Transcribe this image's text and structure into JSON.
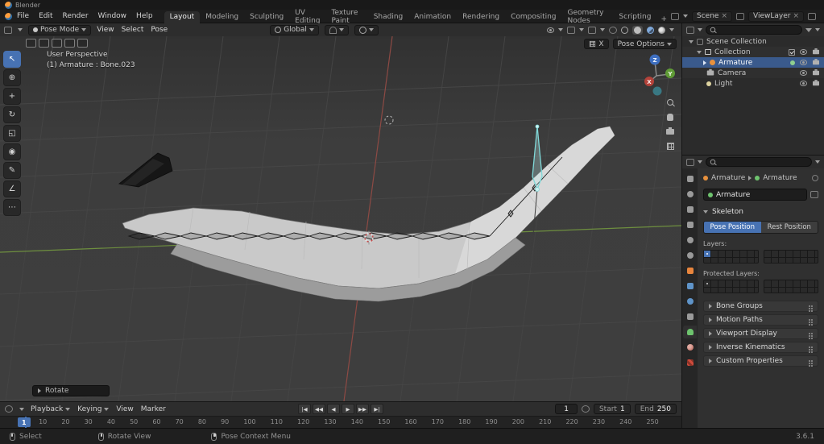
{
  "app": {
    "title": "Blender",
    "version": "3.6.1"
  },
  "menubar": {
    "menus": [
      "File",
      "Edit",
      "Render",
      "Window",
      "Help"
    ]
  },
  "workspaces": {
    "tabs": [
      "Layout",
      "Modeling",
      "Sculpting",
      "UV Editing",
      "Texture Paint",
      "Shading",
      "Animation",
      "Rendering",
      "Compositing",
      "Geometry Nodes",
      "Scripting"
    ],
    "active": "Layout",
    "add": "+"
  },
  "scene_bar": {
    "scene": "Scene",
    "view_layer": "ViewLayer",
    "clear": "×"
  },
  "tools": {
    "items": [
      "↖",
      "⊕",
      "+",
      "↻",
      "◱",
      "◉",
      "✎",
      "∠",
      "⋯"
    ]
  },
  "viewport": {
    "header": {
      "mode": "Pose Mode",
      "menus": [
        "View",
        "Select",
        "Pose"
      ],
      "orientation": "Global"
    },
    "subheader": {
      "mirror": "X",
      "pose_options": "Pose Options"
    },
    "overlay": {
      "line1": "User Perspective",
      "line2": "(1) Armature : Bone.023"
    },
    "operator": "Rotate",
    "gizmo": {
      "x": "X",
      "y": "Y",
      "z": "Z"
    }
  },
  "outliner": {
    "root": "Scene Collection",
    "items": [
      {
        "label": "Collection"
      },
      {
        "label": "Armature"
      },
      {
        "label": "Camera"
      },
      {
        "label": "Light"
      }
    ]
  },
  "properties": {
    "breadcrumb": {
      "object": "Armature",
      "data": "Armature"
    },
    "name": "Armature",
    "skeleton": {
      "title": "Skeleton",
      "pose_position": "Pose Position",
      "rest_position": "Rest Position",
      "layers_label": "Layers:",
      "protected_label": "Protected Layers:"
    },
    "sections": [
      "Bone Groups",
      "Motion Paths",
      "Viewport Display",
      "Inverse Kinematics",
      "Custom Properties"
    ]
  },
  "timeline": {
    "menus": [
      "Playback",
      "Keying",
      "View",
      "Marker"
    ],
    "transport": [
      "|◀",
      "◀◀",
      "◀",
      "▶",
      "▶▶",
      "▶|"
    ],
    "current_frame": "1",
    "start_label": "Start",
    "start_value": "1",
    "end_label": "End",
    "end_value": "250",
    "ticks": [
      "1",
      "10",
      "20",
      "30",
      "40",
      "50",
      "60",
      "70",
      "80",
      "90",
      "100",
      "110",
      "120",
      "130",
      "140",
      "150",
      "160",
      "170",
      "180",
      "190",
      "200",
      "210",
      "220",
      "230",
      "240",
      "250"
    ]
  },
  "statusbar": {
    "items": [
      "Select",
      "Rotate View",
      "Pose Context Menu"
    ],
    "version": "3.6.1"
  },
  "colors": {
    "accent": "#4772b3",
    "selected_row": "#3a5a8c",
    "axis_x": "#8d4a44",
    "axis_y": "#6e8f3f"
  }
}
